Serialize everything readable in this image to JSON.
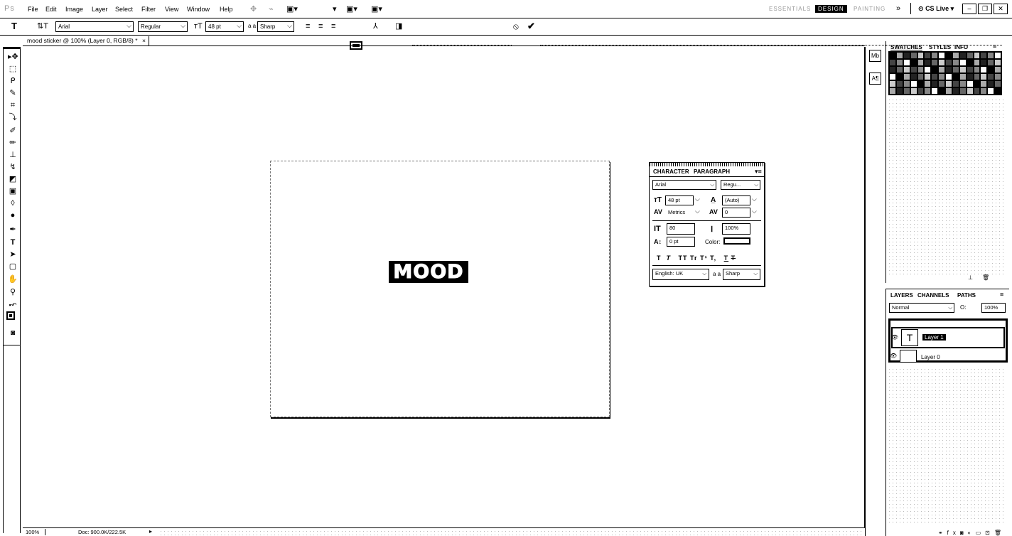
{
  "app": {
    "logo": "Ps"
  },
  "menu": [
    "File",
    "Edit",
    "Image",
    "Layer",
    "Select",
    "Filter",
    "View",
    "Window",
    "Help"
  ],
  "workspaces": {
    "essentials": "ESSENTIALS",
    "design": "DESIGN",
    "painting": "PAINTING",
    "more": "»",
    "cs_live": "CS Live ▾"
  },
  "options": {
    "font_family": "Arial",
    "font_style": "Regular",
    "font_size": "48 pt",
    "aa_label": "a a",
    "antialias": "Sharp"
  },
  "document": {
    "tab_title": "mood sticker @ 100% (Layer 0, RGB/8) *",
    "tab_close": "×",
    "canvas_text": "MOOD"
  },
  "character": {
    "tab_character": "CHARACTER",
    "tab_paragraph": "PARAGRAPH",
    "font_family": "Arial",
    "font_style": "Regu...",
    "font_size": "48 pt",
    "leading": "(Auto)",
    "kerning": "Metrics",
    "tracking": "0",
    "vscale": "80",
    "hscale": "100%",
    "baseline": "0 pt",
    "color_label": "Color:",
    "style_buttons": [
      "T",
      "T",
      "TT",
      "Tr",
      "T¹",
      "T,",
      "T",
      "T"
    ],
    "language": "English: UK",
    "aa_label": "a a",
    "antialias": "Sharp"
  },
  "panels": {
    "swatches": "SWATCHES",
    "styles": "STYLES",
    "info": "INFO",
    "layers": "LAYERS",
    "channels": "CHANNELS",
    "paths": "PATHS",
    "blend_mode": "Normal",
    "opacity_label": "O:",
    "opacity": "100%"
  },
  "layers": [
    {
      "name": "Layer 1",
      "thumb": "T",
      "selected": true
    },
    {
      "name": "Layer 0",
      "thumb": "",
      "selected": false
    }
  ],
  "status": {
    "zoom": "100%",
    "doc": "Doc: 900.0K/222.5K"
  }
}
